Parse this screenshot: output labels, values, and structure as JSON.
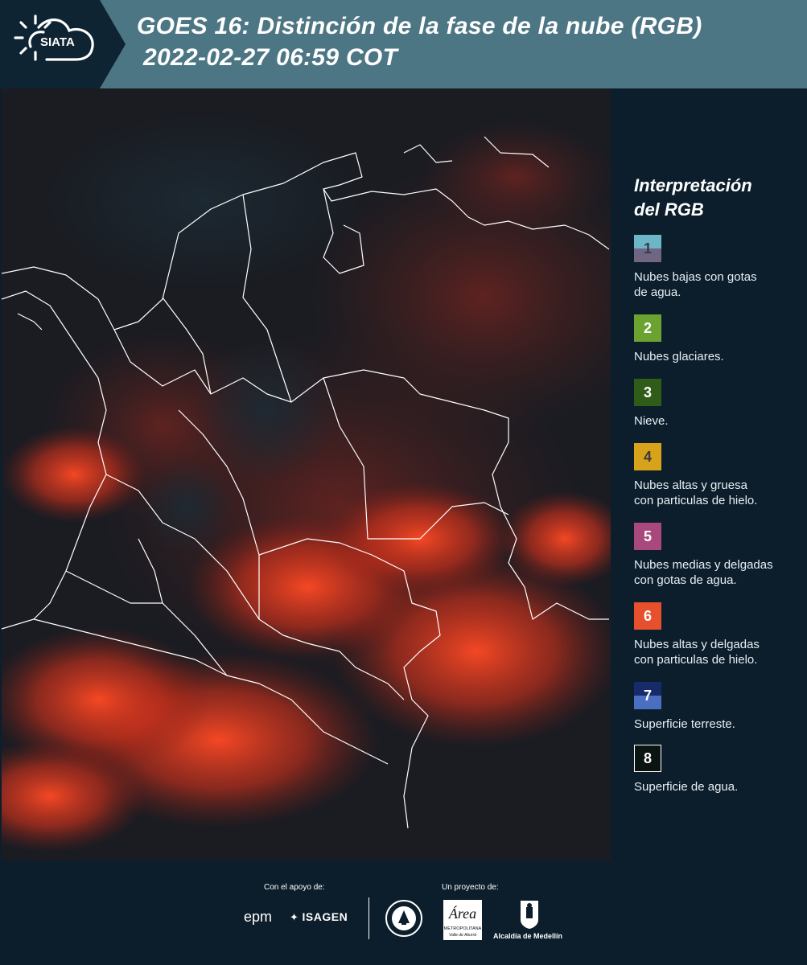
{
  "header": {
    "logo_text": "SIATA",
    "title_line1": "GOES 16: Distinción de la fase de la nube (RGB)",
    "title_line2": "2022-02-27 06:59 COT"
  },
  "legend": {
    "title_line1": "Interpretación",
    "title_line2": "del RGB",
    "items": [
      {
        "num": "1",
        "text_lines": [
          "Nubes bajas con gotas",
          "de agua."
        ],
        "color_top": "#6cb6c7",
        "color_bottom": "#6f6683",
        "num_color": "#3a3a4a"
      },
      {
        "num": "2",
        "text_lines": [
          "Nubes glaciares."
        ],
        "color_top": "#6aa32f",
        "color_bottom": "#6aa32f",
        "num_color": "#ffffff"
      },
      {
        "num": "3",
        "text_lines": [
          "Nieve."
        ],
        "color_top": "#2f5c18",
        "color_bottom": "#2f5c18",
        "num_color": "#ffffff"
      },
      {
        "num": "4",
        "text_lines": [
          "Nubes altas y gruesa",
          "con particulas de hielo."
        ],
        "color_top": "#d9a21b",
        "color_bottom": "#d9a21b",
        "num_color": "#3a3a3a"
      },
      {
        "num": "5",
        "text_lines": [
          "Nubes medias y delgadas",
          "con gotas de agua."
        ],
        "color_top": "#a8487c",
        "color_bottom": "#a8487c",
        "num_color": "#ffffff"
      },
      {
        "num": "6",
        "text_lines": [
          "Nubes altas y delgadas",
          "con particulas de hielo."
        ],
        "color_top": "#e7502d",
        "color_bottom": "#e7502d",
        "num_color": "#ffffff"
      },
      {
        "num": "7",
        "text_lines": [
          "Superficie terreste."
        ],
        "color_top": "#172b6b",
        "color_bottom": "#4a6fc0",
        "num_color": "#ffffff"
      },
      {
        "num": "8",
        "text_lines": [
          "Superficie de agua."
        ],
        "color_top": "#0a1410",
        "color_bottom": "#0a1410",
        "num_color": "#ffffff"
      }
    ]
  },
  "footer": {
    "support_label": "Con el apoyo de:",
    "project_label": "Un proyecto de:",
    "sponsor_epm": "epm",
    "sponsor_isagen": "ISAGEN",
    "partner_area_line1": "Área",
    "partner_area_line2": "METROPOLITANA",
    "partner_area_line3": "Valle de Aburrá",
    "partner_alcaldia": "Alcaldía de Medellín"
  },
  "colors": {
    "header_bg": "#4d7685",
    "panel_bg": "#0c1e2b",
    "cloud_red": "#ff3a1a",
    "border_lines": "#ffffff"
  }
}
